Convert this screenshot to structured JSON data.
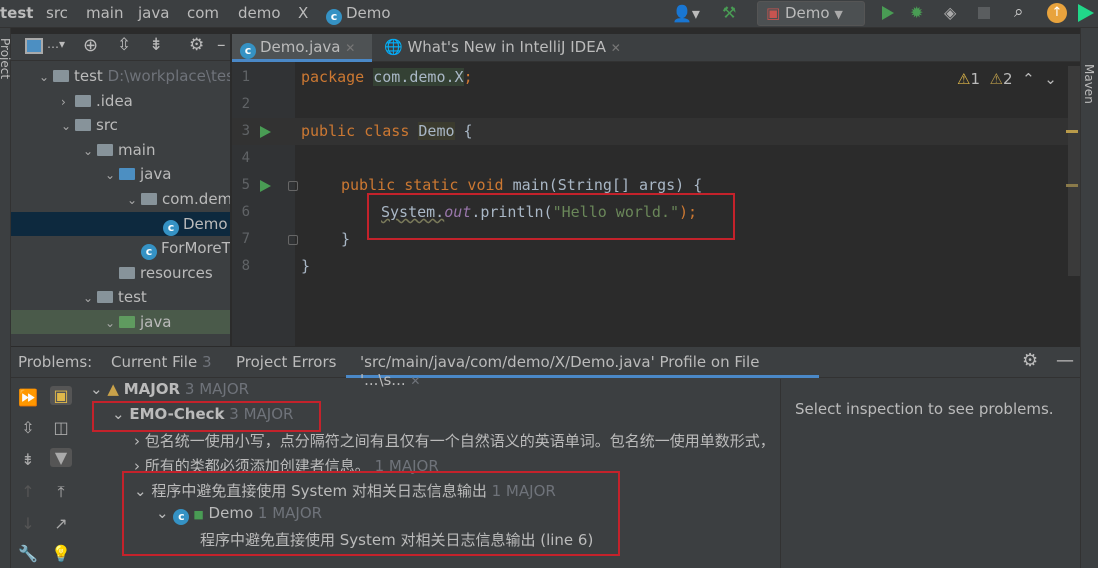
{
  "breadcrumb": [
    "test",
    "src",
    "main",
    "java",
    "com",
    "demo",
    "X",
    "Demo"
  ],
  "toolbar": {
    "run_config": "Demo",
    "icons": [
      "user-icon",
      "hammer-icon",
      "run-icon",
      "debug-icon",
      "coverage-icon",
      "stop-icon",
      "search-icon",
      "update-icon",
      "toolbox-icon"
    ]
  },
  "left_strip": {
    "label": "Project"
  },
  "right_strip": {
    "label": "Maven"
  },
  "project_tree": [
    {
      "label": "test",
      "extra": "D:\\workplace\\test",
      "arrow": "v",
      "indent": 0,
      "icon": "folder"
    },
    {
      "label": ".idea",
      "arrow": ">",
      "indent": 1,
      "icon": "folder"
    },
    {
      "label": "src",
      "arrow": "v",
      "indent": 1,
      "icon": "folder"
    },
    {
      "label": "main",
      "arrow": "v",
      "indent": 2,
      "icon": "folder"
    },
    {
      "label": "java",
      "arrow": "v",
      "indent": 3,
      "icon": "folder-blue"
    },
    {
      "label": "com.demo.X",
      "arrow": "v",
      "indent": 4,
      "icon": "package"
    },
    {
      "label": "Demo",
      "arrow": "",
      "indent": 5,
      "icon": "class",
      "selected": true
    },
    {
      "label": "ForMoreThan",
      "arrow": "",
      "indent": 4,
      "icon": "class"
    },
    {
      "label": "resources",
      "arrow": "",
      "indent": 3,
      "icon": "folder"
    },
    {
      "label": "test",
      "arrow": "v",
      "indent": 2,
      "icon": "folder"
    },
    {
      "label": "java",
      "arrow": "v",
      "indent": 3,
      "icon": "folder-green",
      "selected2": true
    }
  ],
  "editor_tabs": [
    {
      "label": "Demo.java",
      "active": true
    },
    {
      "label": "What's New in IntelliJ IDEA",
      "active": false
    }
  ],
  "inspections": {
    "warnings": "1",
    "weak_warnings": "2"
  },
  "code_lines": [
    "1",
    "2",
    "3",
    "4",
    "5",
    "6",
    "7",
    "8"
  ],
  "code": {
    "l1_kw": "package",
    "l1_pkg": "com.demo.X",
    ";": ";",
    "l3_kw": "public class",
    "l3_name": "Demo",
    "l3_rest": " {",
    "l5_kw": "public static void",
    "l5_rest": " main(String[] args) {",
    "l6_a": "System.",
    "l6_out": "out",
    "l6_b": ".println(",
    "l6_str": "\"Hello world.\"",
    "l6_c": ");",
    "l7": "}",
    "l8": "}"
  },
  "problems": {
    "label": "Problems:",
    "tabs": [
      {
        "label": "Current File",
        "count": "3"
      },
      {
        "label": "Project Errors",
        "count": ""
      },
      {
        "label": "'src/main/java/com/demo/X/Demo.java' Profile on File '...\\s...",
        "count": ""
      }
    ],
    "tree": [
      {
        "label": "MAJOR",
        "count": "3 MAJOR"
      },
      {
        "label": "EMO-Check",
        "count": "3 MAJOR"
      },
      {
        "label": "包名统一使用小写，点分隔符之间有且仅有一个自然语义的英语单词。包名统一使用单数形式，",
        "count": ""
      },
      {
        "label": "所有的类都必须添加创建者信息。",
        "count": "1 MAJOR"
      },
      {
        "label": "程序中避免直接使用 System 对相关日志信息输出",
        "count": "1 MAJOR"
      },
      {
        "label": "Demo",
        "count": "1 MAJOR"
      },
      {
        "label": "程序中避免直接使用 System 对相关日志信息输出 (line 6)",
        "count": ""
      }
    ],
    "details": "Select inspection to see problems."
  },
  "colors": {
    "highlight_box": "#c4222b",
    "accent": "#4a88c7",
    "run": "#499c54"
  }
}
